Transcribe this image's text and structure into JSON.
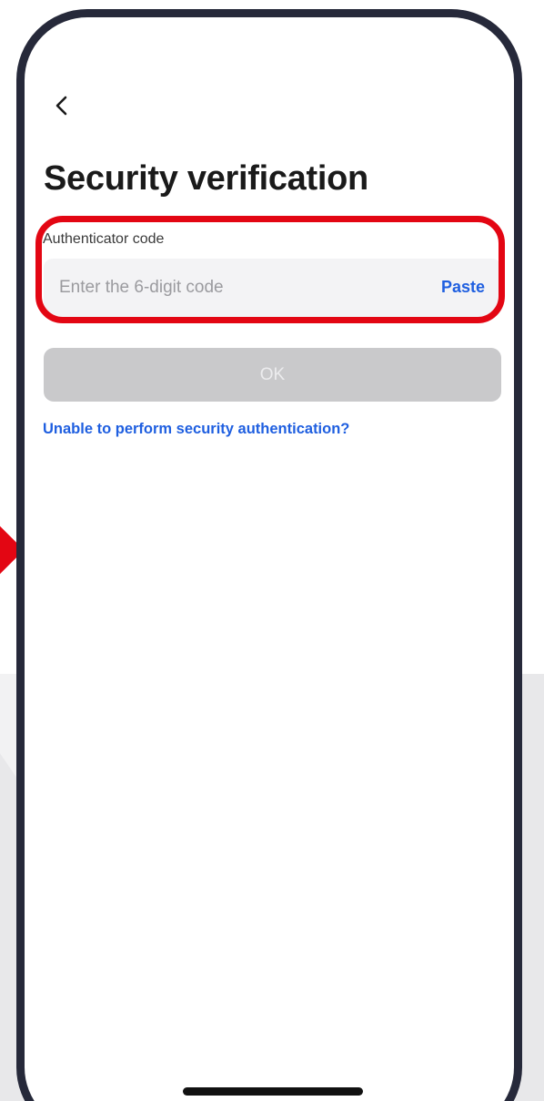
{
  "header": {
    "back_icon": "chevron-left-icon",
    "title": "Security verification"
  },
  "authenticator": {
    "label": "Authenticator code",
    "value": "",
    "placeholder": "Enter the 6-digit code",
    "paste_label": "Paste"
  },
  "actions": {
    "ok_label": "OK",
    "ok_enabled": false,
    "help_link": "Unable to perform security authentication?"
  },
  "colors": {
    "accent": "#1f5fe0",
    "highlight": "#e30613",
    "phone_frame": "#26293a",
    "disabled_button": "#c9c9cb"
  }
}
